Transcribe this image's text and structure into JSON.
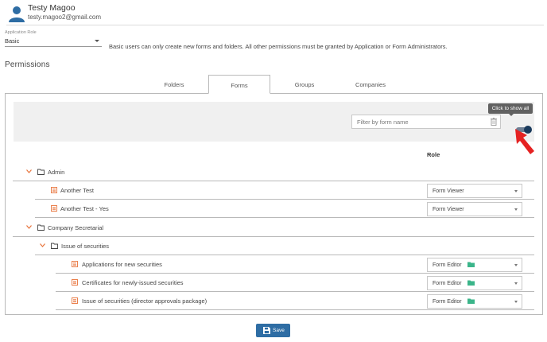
{
  "user": {
    "name": "Testy Magoo",
    "email": "testy.magoo2@gmail.com"
  },
  "application_role": {
    "label": "Application Role",
    "value": "Basic",
    "note": "Basic users can only create new forms and folders. All other permissions must be granted by Application or Form Administrators."
  },
  "permissions": {
    "title": "Permissions",
    "tabs": [
      {
        "label": "Folders",
        "active": false
      },
      {
        "label": "Forms",
        "active": true
      },
      {
        "label": "Groups",
        "active": false
      },
      {
        "label": "Companies",
        "active": false
      }
    ],
    "filter_placeholder": "Filter by form name",
    "toggle_tooltip": "Click to show all",
    "role_column": "Role",
    "tree": [
      {
        "type": "folder",
        "label": "Admin"
      },
      {
        "type": "form",
        "label": "Another Test",
        "role": "Form Viewer"
      },
      {
        "type": "form",
        "label": "Another Test - Yes",
        "role": "Form Viewer"
      },
      {
        "type": "folder",
        "label": "Company Secretarial"
      },
      {
        "type": "folder",
        "label": "Issue of securities"
      },
      {
        "type": "form",
        "label": "Applications for new securities",
        "role": "Form Editor"
      },
      {
        "type": "form",
        "label": "Certificates for newly-issued securities",
        "role": "Form Editor"
      },
      {
        "type": "form",
        "label": "Issue of securities (director approvals package)",
        "role": "Form Editor"
      }
    ]
  },
  "save_label": "Save",
  "colors": {
    "accent_orange": "#e8733a",
    "primary_blue": "#2e6da4",
    "green_folder": "#3bb58a",
    "arrow_red": "#e52222",
    "toggle_knob": "#1a3a5c"
  }
}
